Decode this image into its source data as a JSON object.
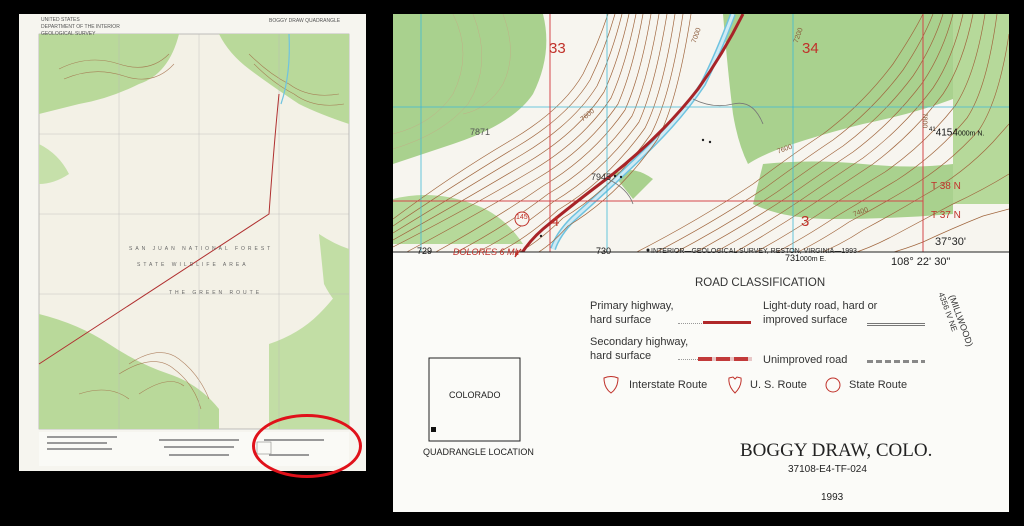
{
  "thumbnail": {
    "header_lines": [
      "UNITED STATES",
      "DEPARTMENT OF THE INTERIOR",
      "GEOLOGICAL SURVEY"
    ],
    "title_small": "BOGGY DRAW QUADRANGLE",
    "area_label_1": "SAN JUAN NATIONAL FOREST",
    "area_label_2": "STATE WILDLIFE AREA",
    "area_label_3": "THE GREEN ROUTE"
  },
  "map": {
    "section_numbers": [
      "33",
      "34",
      "3",
      "4"
    ],
    "route_number": "145",
    "elevation_7871": "7871",
    "elevation_7945": "7945",
    "contour_labels": [
      "7000",
      "7200",
      "7600",
      "7800",
      "7400",
      "7600"
    ],
    "easting_1": "729",
    "easting_2": "730",
    "easting_main": "731",
    "easting_suffix": "000m E.",
    "northing": "4154",
    "northing_suffix": "000m N.",
    "township_1": "T 38 N",
    "township_2": "T 37 N",
    "latitude": "37°30'",
    "longitude": "108° 22' 30\"",
    "direction_label": "DOLORES 6 MI.",
    "credit_line": "INTERIOR—GEOLOGICAL SURVEY, RESTON, VIRGINIA—1993",
    "adjacent_quad_line1": "(MILLWOOD)",
    "adjacent_quad_line2": "4356 IV NE"
  },
  "legend": {
    "title": "ROAD CLASSIFICATION",
    "primary": [
      "Primary highway,",
      "hard surface"
    ],
    "light_duty": [
      "Light-duty road, hard or",
      "improved surface"
    ],
    "secondary": [
      "Secondary highway,",
      "hard surface"
    ],
    "unimproved": "Unimproved road",
    "interstate": "Interstate Route",
    "us_route": "U. S. Route",
    "state_route": "State Route",
    "colors": {
      "primary": "#b0282a",
      "secondary": "#c23a3a",
      "light_duty": "#7c7c7c"
    }
  },
  "location": {
    "state": "COLORADO",
    "caption": "QUADRANGLE LOCATION"
  },
  "title_block": {
    "name": "BOGGY DRAW, COLO.",
    "code": "37108-E4-TF-024",
    "year": "1993"
  },
  "colors": {
    "highlight_ring": "#e0111a",
    "vegetation": "#a9d18e",
    "contours": "#8a5a3a",
    "water": "#6fc3e0"
  }
}
